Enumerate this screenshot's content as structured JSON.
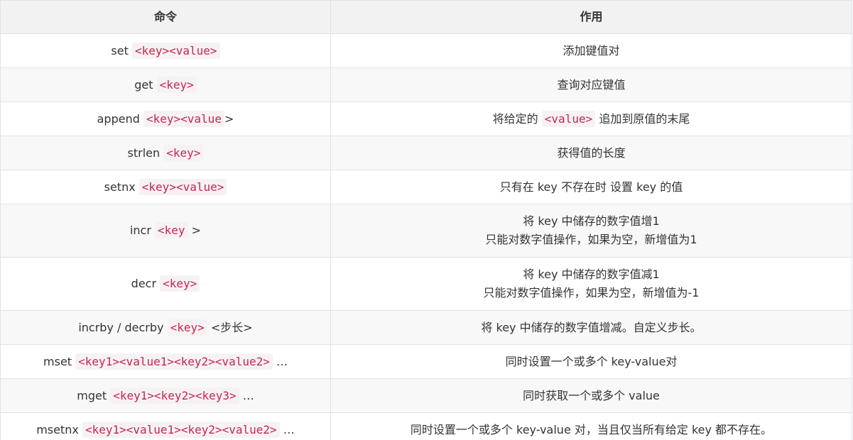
{
  "headers": {
    "command": "命令",
    "purpose": "作用"
  },
  "rows": [
    {
      "cmd": "set",
      "code": "<key><value>",
      "after": "",
      "desc": [
        "添加键值对"
      ]
    },
    {
      "cmd": "get",
      "code": "<key>",
      "after": "",
      "desc": [
        "查询对应键值"
      ]
    },
    {
      "cmd": "append",
      "code": "<key><value",
      "after": ">",
      "desc_pre": "将给定的",
      "desc_code": "<value>",
      "desc_post": "追加到原值的末尾"
    },
    {
      "cmd": "strlen",
      "code": "<key>",
      "after": "",
      "desc": [
        "获得值的长度"
      ]
    },
    {
      "cmd": "setnx",
      "code": "<key><value>",
      "after": "",
      "desc": [
        "只有在 key 不存在时 设置 key 的值"
      ]
    },
    {
      "cmd": "incr",
      "code": "<key",
      "after": ">",
      "desc": [
        "将 key 中储存的数字值增1",
        "只能对数字值操作，如果为空，新增值为1"
      ]
    },
    {
      "cmd": "decr",
      "code": "<key>",
      "after": "",
      "desc": [
        "将 key 中储存的数字值减1",
        "只能对数字值操作，如果为空，新增值为-1"
      ]
    },
    {
      "cmd": "incrby / decrby",
      "code": "<key>",
      "after": "<步长>",
      "desc": [
        "将 key 中储存的数字值增减。自定义步长。"
      ]
    },
    {
      "cmd": "mset",
      "code": "<key1><value1><key2><value2>",
      "after": "…",
      "desc": [
        "同时设置一个或多个 key-value对"
      ]
    },
    {
      "cmd": "mget",
      "code": "<key1><key2><key3>",
      "after": "…",
      "desc": [
        "同时获取一个或多个 value"
      ]
    },
    {
      "cmd": "msetnx",
      "code": "<key1><value1><key2><value2>",
      "after": "…",
      "desc": [
        "同时设置一个或多个 key-value 对，当且仅当所有给定 key 都不存在。"
      ]
    }
  ]
}
